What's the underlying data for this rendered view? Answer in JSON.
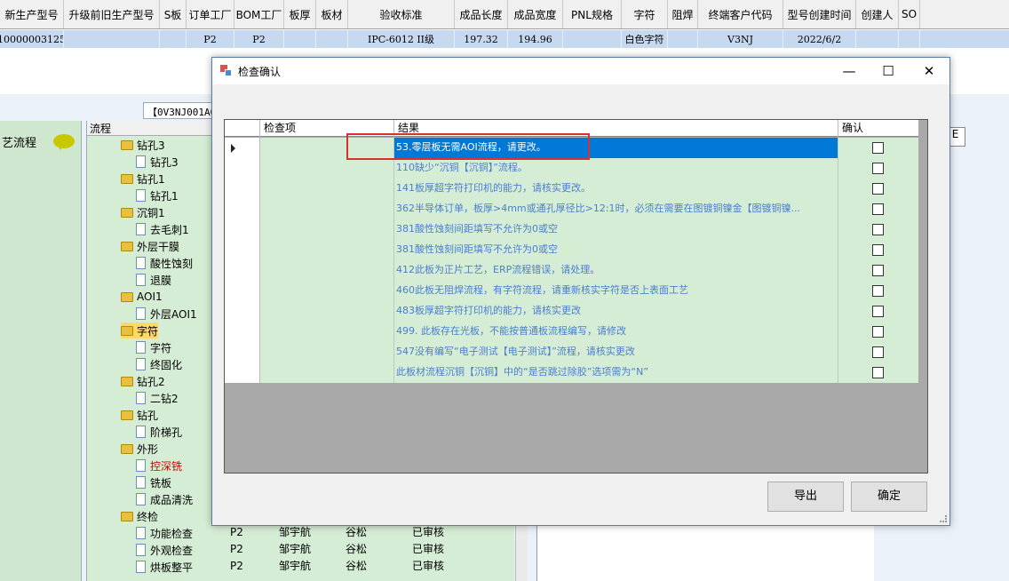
{
  "top_table": {
    "headers": [
      "新生产型号",
      "升级前旧生产型号",
      "S板",
      "订单工厂",
      "BOM工厂",
      "板厚",
      "板材",
      "验收标准",
      "成品长度",
      "成品宽度",
      "PNL规格",
      "字符",
      "阻焊",
      "终端客户代码",
      "型号创建时间",
      "创建人",
      "SO"
    ],
    "row": [
      "10000003125",
      "",
      "",
      "P2",
      "P2",
      "",
      "",
      "IPC-6012 II级",
      "197.32",
      "194.96",
      "",
      "白色字符",
      "",
      "V3NJ",
      "2022/6/2",
      "",
      ""
    ]
  },
  "background": {
    "tab_label": "【0V3NJ001A0",
    "left_label": "艺流程",
    "tree_header": "流程",
    "right_tab": "E",
    "tree": [
      {
        "label": "钻孔3",
        "type": "folder",
        "level": 0
      },
      {
        "label": "钻孔3",
        "type": "file",
        "level": 1
      },
      {
        "label": "钻孔1",
        "type": "folder",
        "level": 0
      },
      {
        "label": "钻孔1",
        "type": "file",
        "level": 1
      },
      {
        "label": "沉铜1",
        "type": "folder",
        "level": 0
      },
      {
        "label": "去毛刺1",
        "type": "file",
        "level": 1
      },
      {
        "label": "外层干膜",
        "type": "folder",
        "level": 0
      },
      {
        "label": "酸性蚀刻",
        "type": "file",
        "level": 1
      },
      {
        "label": "退膜",
        "type": "file",
        "level": 1
      },
      {
        "label": "AOI1",
        "type": "folder",
        "level": 0
      },
      {
        "label": "外层AOI1",
        "type": "file",
        "level": 1
      },
      {
        "label": "字符",
        "type": "folder",
        "level": 0,
        "selected": true
      },
      {
        "label": "字符",
        "type": "file",
        "level": 1
      },
      {
        "label": "终固化",
        "type": "file",
        "level": 1
      },
      {
        "label": "钻孔2",
        "type": "folder",
        "level": 0
      },
      {
        "label": "二钻2",
        "type": "file",
        "level": 1
      },
      {
        "label": "钻孔",
        "type": "folder",
        "level": 0
      },
      {
        "label": "阶梯孔",
        "type": "file",
        "level": 1
      },
      {
        "label": "外形",
        "type": "folder",
        "level": 0
      },
      {
        "label": "控深铣",
        "type": "file",
        "level": 1,
        "red": true
      },
      {
        "label": "铣板",
        "type": "file",
        "level": 1
      },
      {
        "label": "成品清洗",
        "type": "file",
        "level": 1
      },
      {
        "label": "终检",
        "type": "folder",
        "level": 0
      },
      {
        "label": "功能检查",
        "type": "file",
        "level": 1
      },
      {
        "label": "外观检查",
        "type": "file",
        "level": 1
      },
      {
        "label": "烘板整平",
        "type": "file",
        "level": 1
      }
    ],
    "mid_rows": [
      {
        "factory": "P2",
        "person": "邹宇航",
        "name": "谷松",
        "status": "已审核"
      },
      {
        "factory": "P2",
        "person": "邹宇航",
        "name": "谷松",
        "status": "已审核"
      },
      {
        "factory": "P2",
        "person": "邹宇航",
        "name": "谷松",
        "status": "已审核"
      }
    ]
  },
  "dialog": {
    "title": "检查确认",
    "window_buttons": {
      "minimize": "—",
      "maximize": "☐",
      "close": "✕"
    },
    "columns": {
      "item": "检查项",
      "result": "结果",
      "confirm": "确认"
    },
    "rows": [
      {
        "result": "53.零层板无需AOI流程，请更改。",
        "selected": true
      },
      {
        "result": "110缺少“沉铜【沉铜】”流程。"
      },
      {
        "result": "141板厚超字符打印机的能力，请核实更改。"
      },
      {
        "result": "362半导体订单，板厚>4mm或通孔厚径比>12:1时，必须在需要在图镀铜镍金【图镀铜镍..."
      },
      {
        "result": "381酸性蚀刻间距填写不允许为0或空"
      },
      {
        "result": "381酸性蚀刻间距填写不允许为0或空"
      },
      {
        "result": "412此板为正片工艺，ERP流程错误，请处理。"
      },
      {
        "result": "460此板无阻焊流程，有字符流程，请重新核实字符是否上表面工艺"
      },
      {
        "result": "483板厚超字符打印机的能力，请核实更改"
      },
      {
        "result": "499. 此板存在光板，不能按普通板流程编写，请修改"
      },
      {
        "result": "547没有编写“电子测试【电子测试】”流程，请核实更改"
      },
      {
        "result": "此板材流程沉铜【沉铜】中的“是否跳过除胶”选项需为“N”"
      }
    ],
    "buttons": {
      "export": "导出",
      "ok": "确定"
    }
  },
  "colors": {
    "grid_row": "#d5ecd5",
    "selection": "#0078d7",
    "result_text": "#4a7fd0",
    "highlight_box": "#d93030"
  }
}
